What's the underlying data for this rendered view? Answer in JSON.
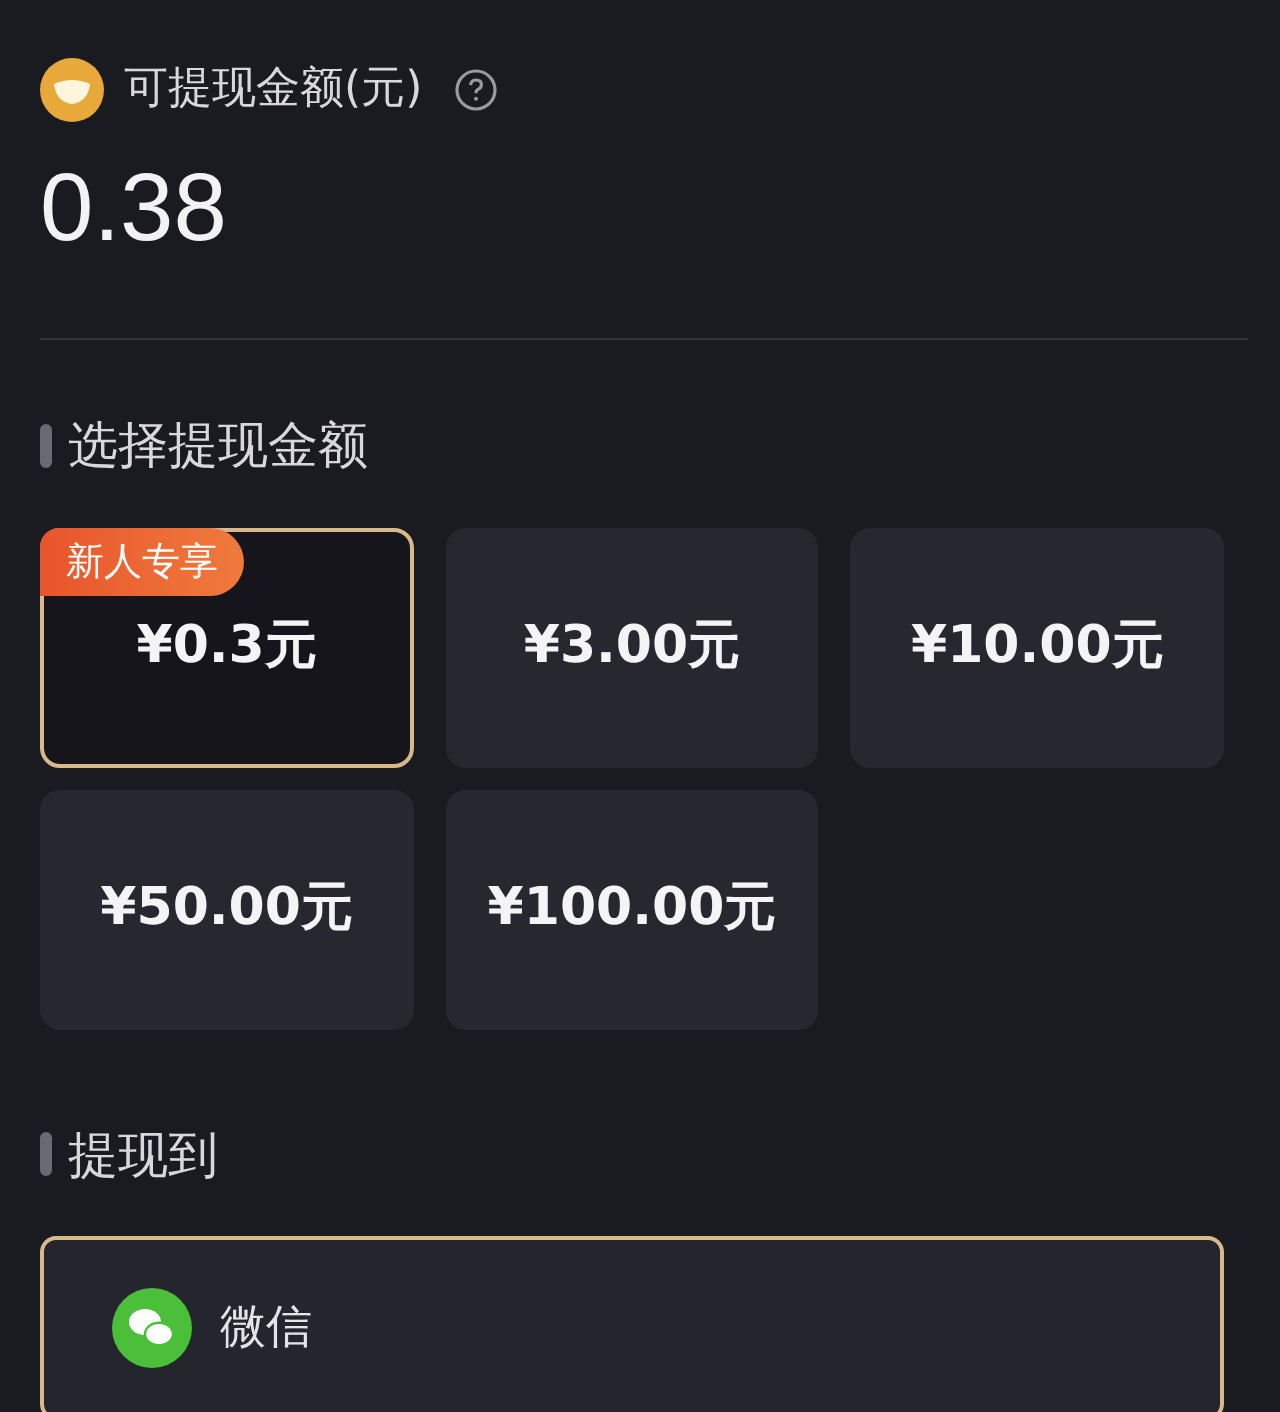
{
  "balance": {
    "label": "可提现金额(元)",
    "amount": "0.38"
  },
  "amount_section": {
    "title": "选择提现金额",
    "options": [
      {
        "label": "¥0.3元",
        "badge": "新人专享",
        "selected": true
      },
      {
        "label": "¥3.00元",
        "selected": false
      },
      {
        "label": "¥10.00元",
        "selected": false
      },
      {
        "label": "¥50.00元",
        "selected": false
      },
      {
        "label": "¥100.00元",
        "selected": false
      }
    ]
  },
  "withdraw_to": {
    "title": "提现到",
    "methods": [
      {
        "kind": "wechat",
        "label": "微信",
        "selected": true
      }
    ]
  }
}
